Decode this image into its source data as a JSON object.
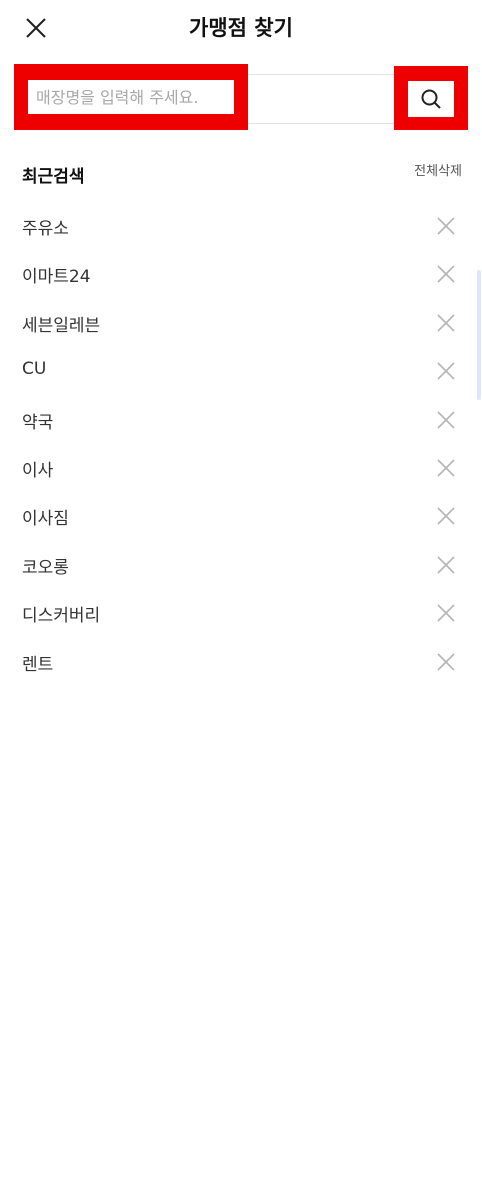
{
  "header": {
    "title": "가맹점 찾기",
    "close_icon": "close-icon"
  },
  "search": {
    "placeholder": "매장명을 입력해 주세요.",
    "value": "",
    "button_icon": "search-icon"
  },
  "recent": {
    "title": "최근검색",
    "clear_all_label": "전체삭제",
    "items": [
      {
        "label": "주유소"
      },
      {
        "label": "이마트24"
      },
      {
        "label": "세븐일레븐"
      },
      {
        "label": "CU"
      },
      {
        "label": "약국"
      },
      {
        "label": "이사"
      },
      {
        "label": "이사짐"
      },
      {
        "label": "코오롱"
      },
      {
        "label": "디스커버리"
      },
      {
        "label": "렌트"
      }
    ],
    "delete_icon": "close-icon"
  },
  "colors": {
    "highlight_frame": "#ee0000",
    "scroll_indicator": "#dfe7f7"
  }
}
